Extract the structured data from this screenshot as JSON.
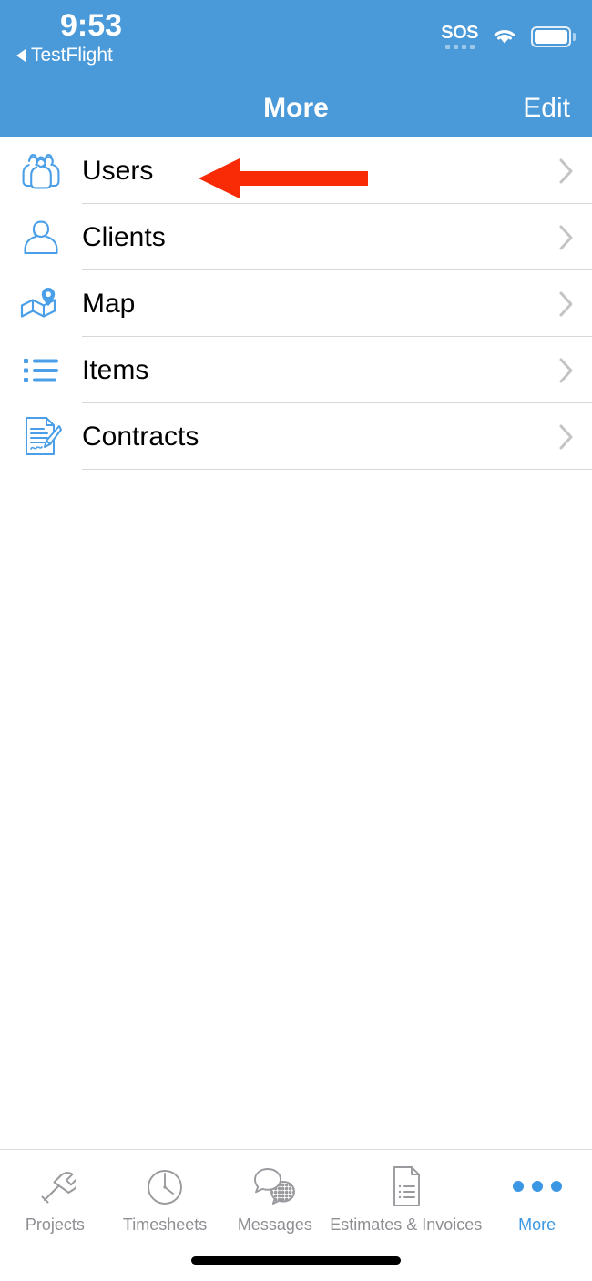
{
  "status_bar": {
    "time": "9:53",
    "back_app_label": "TestFlight",
    "back_icon": "back-triangle-icon",
    "sos_label": "SOS",
    "wifi_icon": "wifi-icon",
    "battery_icon": "battery-icon"
  },
  "nav_bar": {
    "title": "More",
    "edit_label": "Edit",
    "background_color": "#4a99d8",
    "text_color": "#ffffff"
  },
  "list": {
    "accent_color": "#4a9fe8",
    "separator_color": "#d7d7d9",
    "chevron_icon": "chevron-right-icon",
    "items": [
      {
        "label": "Users",
        "icon": "users-group-icon"
      },
      {
        "label": "Clients",
        "icon": "person-icon"
      },
      {
        "label": "Map",
        "icon": "map-pin-icon"
      },
      {
        "label": "Items",
        "icon": "bulleted-list-icon"
      },
      {
        "label": "Contracts",
        "icon": "contract-signature-icon"
      }
    ]
  },
  "annotation": {
    "type": "arrow",
    "direction": "left",
    "color": "#f92a06",
    "points_at": "Users"
  },
  "tab_bar": {
    "active_tab": "More",
    "active_color": "#3b97e3",
    "inactive_color": "#8e8e93",
    "tabs": [
      {
        "label": "Projects",
        "icon": "hammer-icon",
        "active": false
      },
      {
        "label": "Timesheets",
        "icon": "clock-icon",
        "active": false
      },
      {
        "label": "Messages",
        "icon": "speech-bubbles-icon",
        "active": false
      },
      {
        "label": "Estimates & Invoices",
        "icon": "document-list-icon",
        "active": false
      },
      {
        "label": "More",
        "icon": "ellipsis-icon",
        "active": true
      }
    ]
  },
  "home_indicator": "home-indicator"
}
